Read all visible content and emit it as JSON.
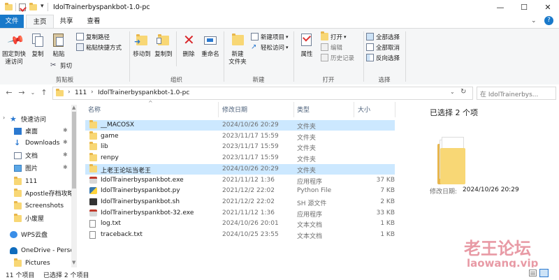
{
  "window": {
    "title": "IdolTrainerbyspankbot-1.0-pc",
    "controls": {
      "minimize": "—",
      "maximize": "☐",
      "close": "✕"
    }
  },
  "ribbon_tabs": [
    "文件",
    "主页",
    "共享",
    "查看"
  ],
  "ribbon": {
    "clipboard": {
      "pin": "固定到快\n速访问",
      "copy": "复制",
      "paste": "粘贴",
      "copy_path": "复制路径",
      "paste_shortcut": "粘贴快捷方式",
      "cut": "剪切",
      "group": "剪贴板"
    },
    "organize": {
      "move_to": "移动到",
      "copy_to": "复制到",
      "delete": "删除",
      "rename": "重命名",
      "group": "组织"
    },
    "new": {
      "new_folder": "新建\n文件夹",
      "new_item": "新建项目",
      "easy_access": "轻松访问",
      "group": "新建"
    },
    "open": {
      "properties": "属性",
      "open": "打开",
      "edit": "编辑",
      "history": "历史记录",
      "group": "打开"
    },
    "select": {
      "select_all": "全部选择",
      "select_none": "全部取消",
      "invert": "反向选择",
      "group": "选择"
    }
  },
  "address": {
    "path": [
      "111",
      "IdolTrainerbyspankbot-1.0-pc"
    ],
    "search_placeholder": "在 IdolTrainerbys..."
  },
  "nav": [
    {
      "label": "快速访问",
      "icon": "star-icon",
      "pinned": false
    },
    {
      "label": "桌面",
      "icon": "desktop-icon",
      "pinned": true
    },
    {
      "label": "Downloads",
      "icon": "download-icon",
      "pinned": true
    },
    {
      "label": "文档",
      "icon": "documents-icon",
      "pinned": true
    },
    {
      "label": "图片",
      "icon": "pictures-icon",
      "pinned": true
    },
    {
      "label": "111",
      "icon": "folder-icon",
      "pinned": false
    },
    {
      "label": "Apostle存档攻略",
      "icon": "folder-icon",
      "pinned": false
    },
    {
      "label": "Screenshots",
      "icon": "folder-icon",
      "pinned": false
    },
    {
      "label": "小废屋",
      "icon": "folder-icon",
      "pinned": false
    },
    {
      "label": "WPS云盘",
      "icon": "cloud-icon",
      "pinned": false
    },
    {
      "label": "OneDrive - Perso",
      "icon": "onedrive-icon",
      "pinned": false
    },
    {
      "label": "Pictures",
      "icon": "folder-icon",
      "pinned": false
    }
  ],
  "columns": {
    "name": "名称",
    "date": "修改日期",
    "type": "类型",
    "size": "大小"
  },
  "files": [
    {
      "name": "__MACOSX",
      "date": "2024/10/26 20:29",
      "type": "文件夹",
      "size": "",
      "kind": "folder",
      "selected": true
    },
    {
      "name": "game",
      "date": "2023/11/17 15:59",
      "type": "文件夹",
      "size": "",
      "kind": "folder",
      "selected": false
    },
    {
      "name": "lib",
      "date": "2023/11/17 15:59",
      "type": "文件夹",
      "size": "",
      "kind": "folder",
      "selected": false
    },
    {
      "name": "renpy",
      "date": "2023/11/17 15:59",
      "type": "文件夹",
      "size": "",
      "kind": "folder",
      "selected": false
    },
    {
      "name": "上老王论坛当老王",
      "date": "2024/10/26 20:29",
      "type": "文件夹",
      "size": "",
      "kind": "folder",
      "selected": true
    },
    {
      "name": "IdolTrainerbyspankbot.exe",
      "date": "2021/11/12 1:36",
      "type": "应用程序",
      "size": "37 KB",
      "kind": "exe",
      "selected": false
    },
    {
      "name": "IdolTrainerbyspankbot.py",
      "date": "2021/12/2 22:02",
      "type": "Python File",
      "size": "7 KB",
      "kind": "py",
      "selected": false
    },
    {
      "name": "IdolTrainerbyspankbot.sh",
      "date": "2021/12/2 22:02",
      "type": "SH 源文件",
      "size": "2 KB",
      "kind": "sh",
      "selected": false
    },
    {
      "name": "IdolTrainerbyspankbot-32.exe",
      "date": "2021/11/12 1:36",
      "type": "应用程序",
      "size": "33 KB",
      "kind": "exe",
      "selected": false
    },
    {
      "name": "log.txt",
      "date": "2024/10/26 20:01",
      "type": "文本文档",
      "size": "1 KB",
      "kind": "txt",
      "selected": false
    },
    {
      "name": "traceback.txt",
      "date": "2024/10/25 23:55",
      "type": "文本文档",
      "size": "1 KB",
      "kind": "txt",
      "selected": false
    }
  ],
  "preview": {
    "title": "已选择 2 个项",
    "modified_label": "修改日期:",
    "modified_value": "2024/10/26 20:29"
  },
  "status": {
    "count": "11 个项目",
    "selected": "已选择 2 个项目"
  },
  "watermark": {
    "text": "老王论坛",
    "url": "laowang.vip"
  },
  "colors": {
    "accent": "#1979ca",
    "selection": "#cce8ff",
    "folder": "#f8d775",
    "watermark": "#e89aa5"
  }
}
